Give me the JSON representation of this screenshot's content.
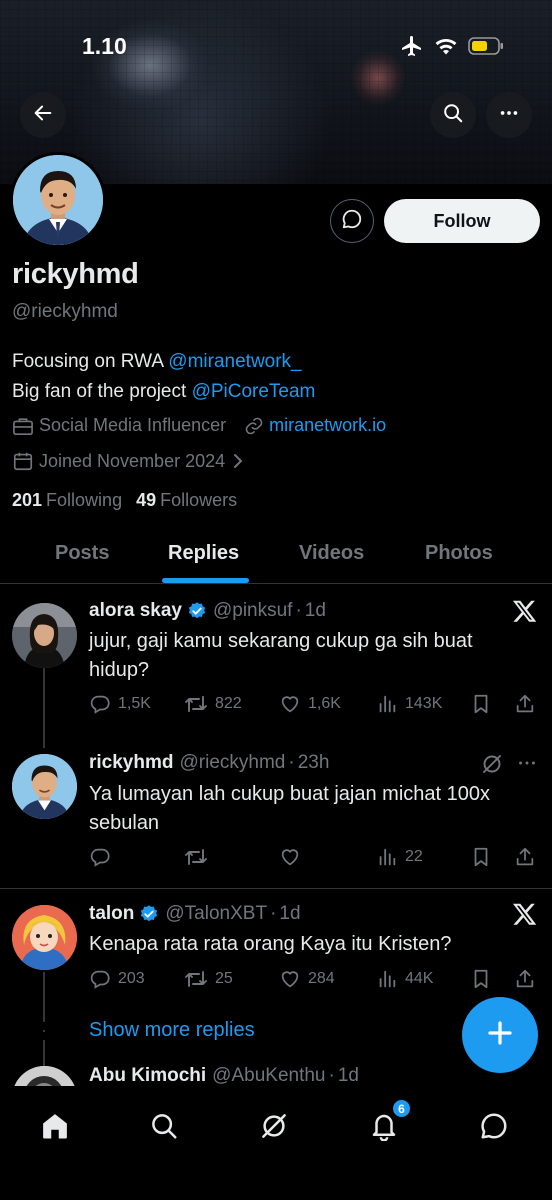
{
  "status_bar": {
    "time": "1.10"
  },
  "profile": {
    "display_name": "rickyhmd",
    "handle": "@rieckyhmd",
    "bio_line1_text": "Focusing on RWA ",
    "bio_line1_link": "@miranetwork_",
    "bio_line2_text": "Big fan of the project ",
    "bio_line2_link": "@PiCoreTeam",
    "category": "Social Media Influencer",
    "website": "miranetwork.io",
    "joined": "Joined November 2024",
    "following_count": "201",
    "following_label": "Following",
    "followers_count": "49",
    "followers_label": "Followers"
  },
  "buttons": {
    "follow": "Follow"
  },
  "tabs": [
    "Posts",
    "Replies",
    "Videos",
    "Photos"
  ],
  "active_tab": "Replies",
  "tweets": [
    {
      "name": "alora skay",
      "handle": "@pinksuf",
      "time": "1d",
      "verified": true,
      "text": "jujur, gaji kamu sekarang cukup ga sih buat hidup?",
      "replies": "1,5K",
      "retweets": "822",
      "likes": "1,6K",
      "views": "143K"
    },
    {
      "name": "rickyhmd",
      "handle": "@rieckyhmd",
      "time": "23h",
      "verified": false,
      "text": "Ya lumayan lah cukup buat jajan michat 100x sebulan",
      "replies": "",
      "retweets": "",
      "likes": "",
      "views": "22"
    },
    {
      "name": "talon",
      "handle": "@TalonXBT",
      "time": "1d",
      "verified": true,
      "text": "Kenapa rata rata orang Kaya itu Kristen?",
      "replies": "203",
      "retweets": "25",
      "likes": "284",
      "views": "44K"
    },
    {
      "name": "Abu Kimochi",
      "handle": "@AbuKenthu",
      "time": "1d"
    }
  ],
  "show_more_replies": "Show more replies",
  "notifications_badge": "6",
  "colors": {
    "accent": "#1d9bf0",
    "background": "#000000",
    "muted": "#71767b"
  }
}
